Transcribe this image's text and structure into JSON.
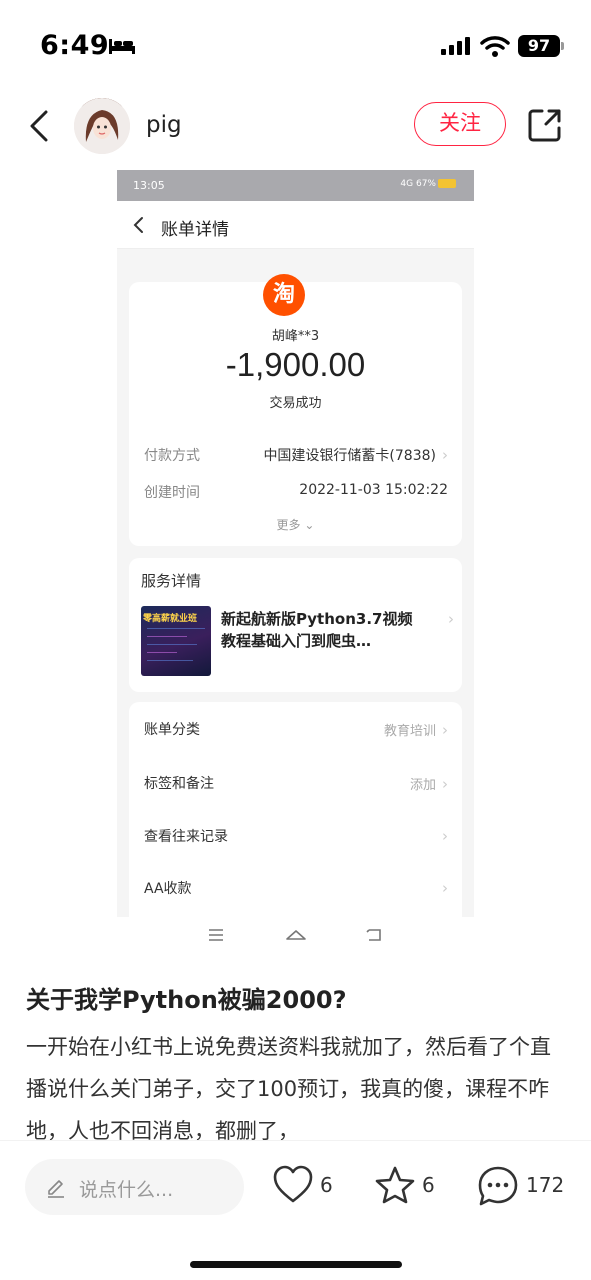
{
  "status_bar": {
    "time": "6:49",
    "battery": "97",
    "icons": [
      "bed-icon",
      "signal-icon",
      "wifi-icon",
      "battery-icon"
    ]
  },
  "header": {
    "username": "pig",
    "follow_label": "关注",
    "icons": [
      "chevron-left-icon",
      "share-icon"
    ]
  },
  "screenshot": {
    "status_time": "13:05",
    "status_right": "4G 67%",
    "nav_title": "账单详情",
    "merchant_logo": "淘",
    "payee": "胡峰**3",
    "amount": "-1,900.00",
    "status": "交易成功",
    "rows": [
      {
        "label": "付款方式",
        "value": "中国建设银行储蓄卡(7838)"
      },
      {
        "label": "创建时间",
        "value": "2022-11-03 15:02:22"
      }
    ],
    "more_label": "更多",
    "service": {
      "title": "服务详情",
      "thumb_text": "零高薪就业班",
      "name": "新起航新版Python3.7视频教程基础入门到爬虫…"
    },
    "list": [
      {
        "label": "账单分类",
        "value": "教育培训"
      },
      {
        "label": "标签和备注",
        "value": "添加"
      },
      {
        "label": "查看往来记录",
        "value": ""
      },
      {
        "label": "AA收款",
        "value": ""
      }
    ]
  },
  "post": {
    "title": "关于我学Python被骗2000?",
    "body": "一开始在小红书上说免费送资料我就加了，然后看了个直播说什么关门弟子，交了100预订，我真的傻，课程不咋地，人也不回消息，都删了，"
  },
  "bottom_bar": {
    "comment_placeholder": "说点什么...",
    "like_count": "6",
    "collect_count": "6",
    "comment_count": "172"
  },
  "colors": {
    "accent": "#ff2442",
    "taobao": "#ff5000"
  }
}
